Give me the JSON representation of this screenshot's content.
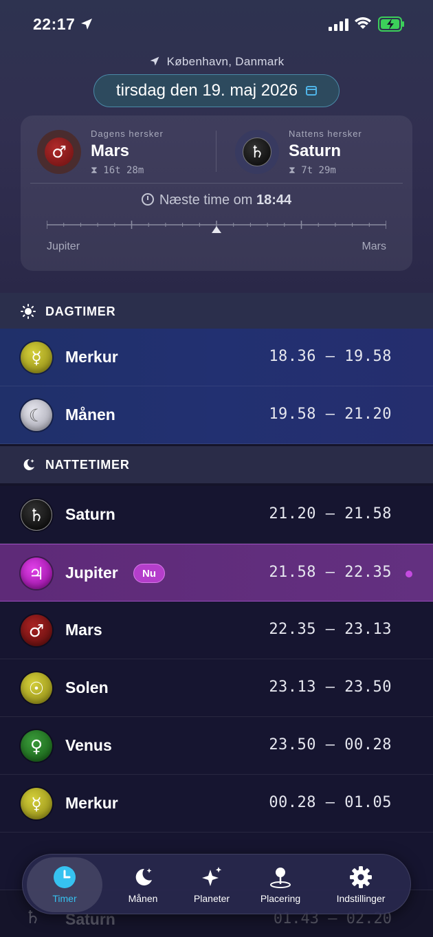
{
  "status_bar": {
    "time": "22:17"
  },
  "header": {
    "location": "København, Danmark",
    "date": "tirsdag den 19. maj 2026"
  },
  "rulers": {
    "day": {
      "caption": "Dagens hersker",
      "planet": "Mars",
      "duration": "16t 28m",
      "symbol": "♂"
    },
    "night": {
      "caption": "Nattens hersker",
      "planet": "Saturn",
      "duration": "7t 29m",
      "symbol": "♄"
    },
    "next_hour_prefix": "Næste time om",
    "next_hour_time": "18:44",
    "timeline_left": "Jupiter",
    "timeline_right": "Mars",
    "timeline_position": 0.5
  },
  "sections": {
    "day": "DAGTIMER",
    "night": "NATTETIMER"
  },
  "day_hours": [
    {
      "planet": "Merkur",
      "symbol": "☿",
      "range": "18.36 – 19.58"
    },
    {
      "planet": "Månen",
      "symbol": "☾",
      "range": "19.58 – 21.20"
    }
  ],
  "night_hours": [
    {
      "planet": "Saturn",
      "symbol": "♄",
      "range": "21.20 – 21.58"
    },
    {
      "planet": "Jupiter",
      "symbol": "♃",
      "range": "21.58 – 22.35",
      "badge": "Nu"
    },
    {
      "planet": "Mars",
      "symbol": "♂",
      "range": "22.35 – 23.13"
    },
    {
      "planet": "Solen",
      "symbol": "☉",
      "range": "23.13 – 23.50"
    },
    {
      "planet": "Venus",
      "symbol": "♀",
      "range": "23.50 – 00.28"
    },
    {
      "planet": "Merkur",
      "symbol": "☿",
      "range": "00.28 – 01.05"
    }
  ],
  "faded_row": {
    "planet": "Saturn",
    "symbol": "♄",
    "range": "01.43 – 02.20"
  },
  "tabs": [
    {
      "label": "Timer",
      "icon": "clock-icon"
    },
    {
      "label": "Månen",
      "icon": "moon-stars-icon"
    },
    {
      "label": "Planeter",
      "icon": "sparkles-icon"
    },
    {
      "label": "Placering",
      "icon": "map-pin-icon"
    },
    {
      "label": "Indstillinger",
      "icon": "gear-icon"
    }
  ],
  "colors": {
    "accent": "#36c2f0",
    "current_hour": "#633080",
    "mars": "#8b1a1a",
    "saturn": "#1a1a1a",
    "jupiter": "#b01fb8",
    "merkur": "#b8b42a",
    "maanen": "#c8c8d0",
    "solen": "#b8b42a",
    "venus": "#2a7a2a"
  }
}
